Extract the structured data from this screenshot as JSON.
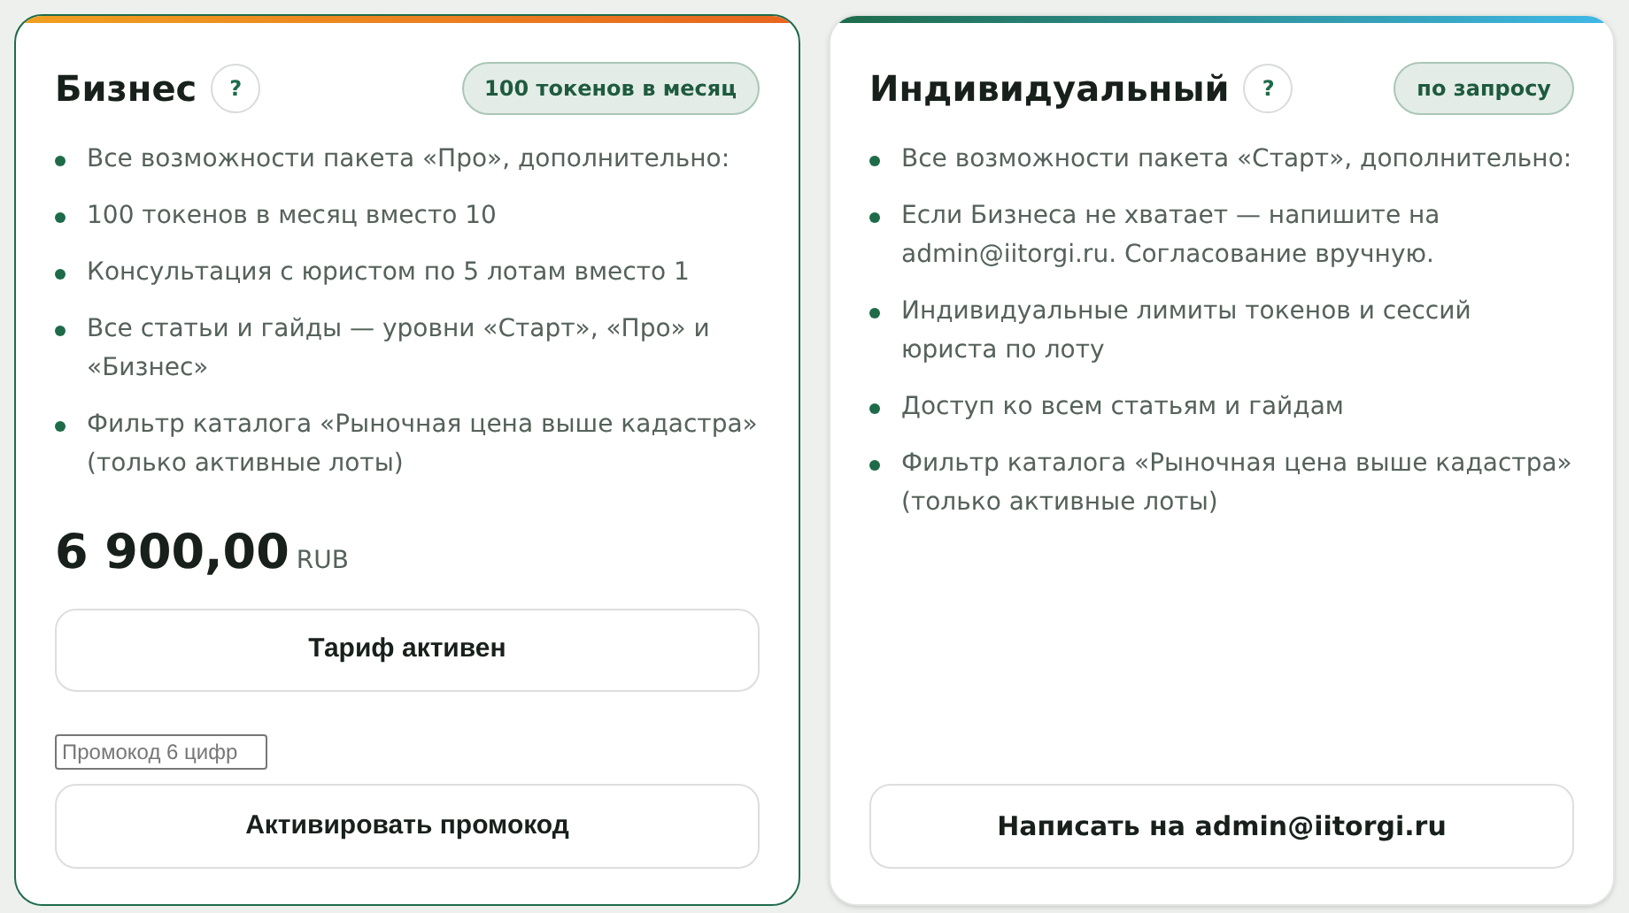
{
  "plans": [
    {
      "kind": "warm",
      "selected": true,
      "title": "Бизнес",
      "help": "?",
      "badge": "100 токенов в месяц",
      "features": [
        "Все возможности пакета «Про», дополнительно:",
        "100 токенов в месяц вместо 10",
        "Консультация с юристом по 5 лотам вместо 1",
        "Все статьи и гайды — уровни «Старт», «Про» и «Бизнес»",
        "Фильтр каталога «Рыночная цена выше кадастра» (только активные лоты)"
      ],
      "price": {
        "amount": "6 900,00",
        "currency": "RUB"
      },
      "status_button": "Тариф активен",
      "promo": {
        "placeholder": "Промокод 6 цифр",
        "button": "Активировать промокод"
      }
    },
    {
      "kind": "cool",
      "selected": false,
      "title": "Индивидуальный",
      "help": "?",
      "badge": "по запросу",
      "features": [
        "Все возможности пакета «Старт», дополнительно:",
        "Если Бизнеса не хватает — напишите на admin@iitorgi.ru. Согласование вручную.",
        "Индивидуальные лимиты токенов и сессий юриста по лоту",
        "Доступ ко всем статьям и гайдам",
        "Фильтр каталога «Рыночная цена выше кадастра» (только активные лоты)"
      ],
      "contact_button": "Написать на admin@iitorgi.ru"
    }
  ]
}
